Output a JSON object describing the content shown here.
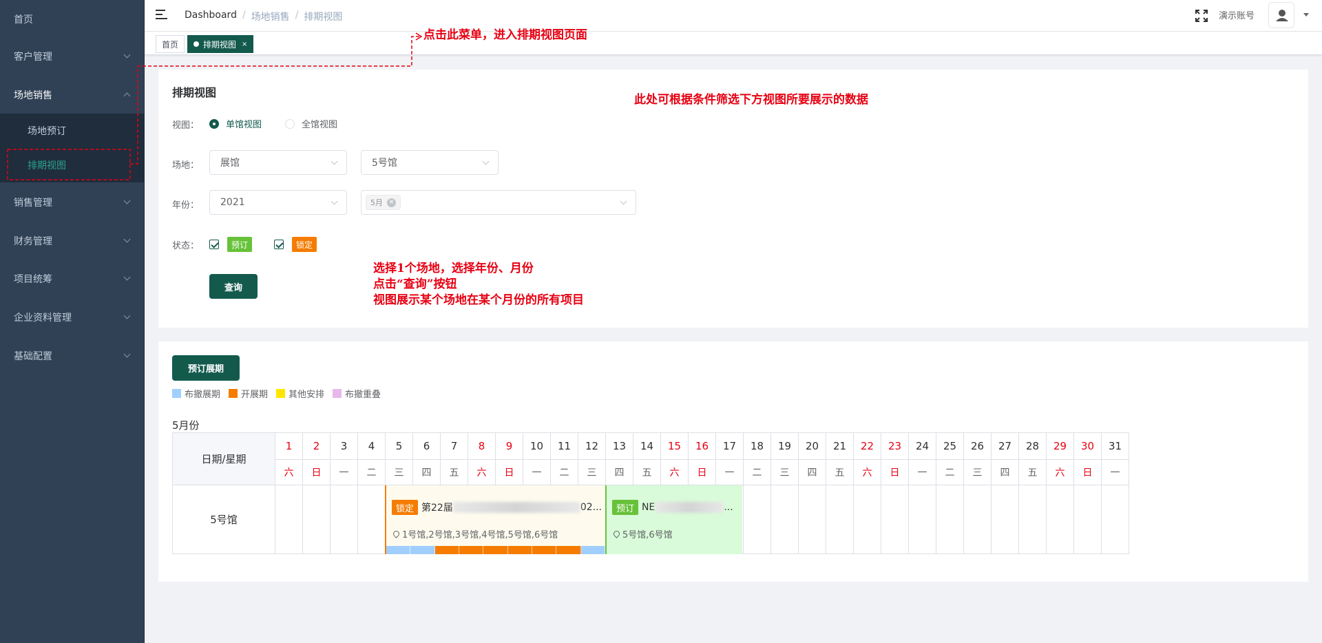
{
  "sidebar": {
    "items": [
      {
        "label": "首页"
      },
      {
        "label": "客户管理"
      },
      {
        "label": "场地销售"
      },
      {
        "label": "销售管理"
      },
      {
        "label": "财务管理"
      },
      {
        "label": "项目统筹"
      },
      {
        "label": "企业资料管理"
      },
      {
        "label": "基础配置"
      }
    ],
    "subitems": [
      {
        "label": "场地预订"
      },
      {
        "label": "排期视图"
      }
    ]
  },
  "navbar": {
    "breadcrumb": [
      "Dashboard",
      "场地销售",
      "排期视图"
    ],
    "account": "演示账号"
  },
  "tags": [
    {
      "label": "首页"
    },
    {
      "label": "排期视图",
      "close": "×"
    }
  ],
  "filter": {
    "title": "排期视图",
    "view_label": "视图：",
    "view_options": [
      "单馆视图",
      "全馆视图"
    ],
    "venue_label": "场地：",
    "venue_type": "展馆",
    "venue_hall": "5号馆",
    "year_label": "年份：",
    "year": "2021",
    "month_chip": "5月",
    "status_label": "状态：",
    "status_booked": "预订",
    "status_locked": "锁定",
    "query_button": "查询"
  },
  "annotations": {
    "menu_hint": "点击此菜单，进入排期视图页面",
    "filter_hint": "此处可根据条件筛选下方视图所要展示的数据",
    "steps_line1": "选择1个场地，选择年份、月份",
    "steps_line2": "点击“查询”按钮",
    "steps_line3": "视图展示某个场地在某个月份的所有项目"
  },
  "schedule": {
    "book_button": "预订展期",
    "legend": [
      {
        "label": "布撤展期",
        "color": "#a0cfff"
      },
      {
        "label": "开展期",
        "color": "#f57c00"
      },
      {
        "label": "其他安排",
        "color": "#ffe600"
      },
      {
        "label": "布撤重叠",
        "color": "#e8b8ec"
      }
    ],
    "month_label": "5月份",
    "header_label": "日期/星期",
    "days": [
      "1",
      "2",
      "3",
      "4",
      "5",
      "6",
      "7",
      "8",
      "9",
      "10",
      "11",
      "12",
      "13",
      "14",
      "15",
      "16",
      "17",
      "18",
      "19",
      "20",
      "21",
      "22",
      "23",
      "24",
      "25",
      "26",
      "27",
      "28",
      "29",
      "30",
      "31"
    ],
    "weekdays": [
      "六",
      "日",
      "一",
      "二",
      "三",
      "四",
      "五",
      "六",
      "日",
      "一",
      "二",
      "三",
      "四",
      "五",
      "六",
      "日",
      "一",
      "二",
      "三",
      "四",
      "五",
      "六",
      "日",
      "一",
      "二",
      "三",
      "四",
      "五",
      "六",
      "日",
      "一"
    ],
    "weekend_indexes": [
      0,
      1,
      7,
      8,
      14,
      15,
      21,
      22,
      28,
      29
    ],
    "row_label": "5号馆",
    "event1": {
      "status": "锁定",
      "title_start": "第22届",
      "title_end": "02...",
      "location": "1号馆,2号馆,3号馆,4号馆,5号馆,6号馆",
      "bar_colors": [
        "#a0cfff",
        "#a0cfff",
        "#f57c00",
        "#f57c00",
        "#f57c00",
        "#f57c00",
        "#f57c00",
        "#f57c00",
        "#a0cfff"
      ]
    },
    "event2": {
      "status": "预订",
      "title_start": "NE",
      "title_end": "...",
      "location": "5号馆,6号馆"
    }
  },
  "colors": {
    "primary": "#135a4d",
    "sidebar_bg": "#304156",
    "annotation": "#e60012"
  }
}
